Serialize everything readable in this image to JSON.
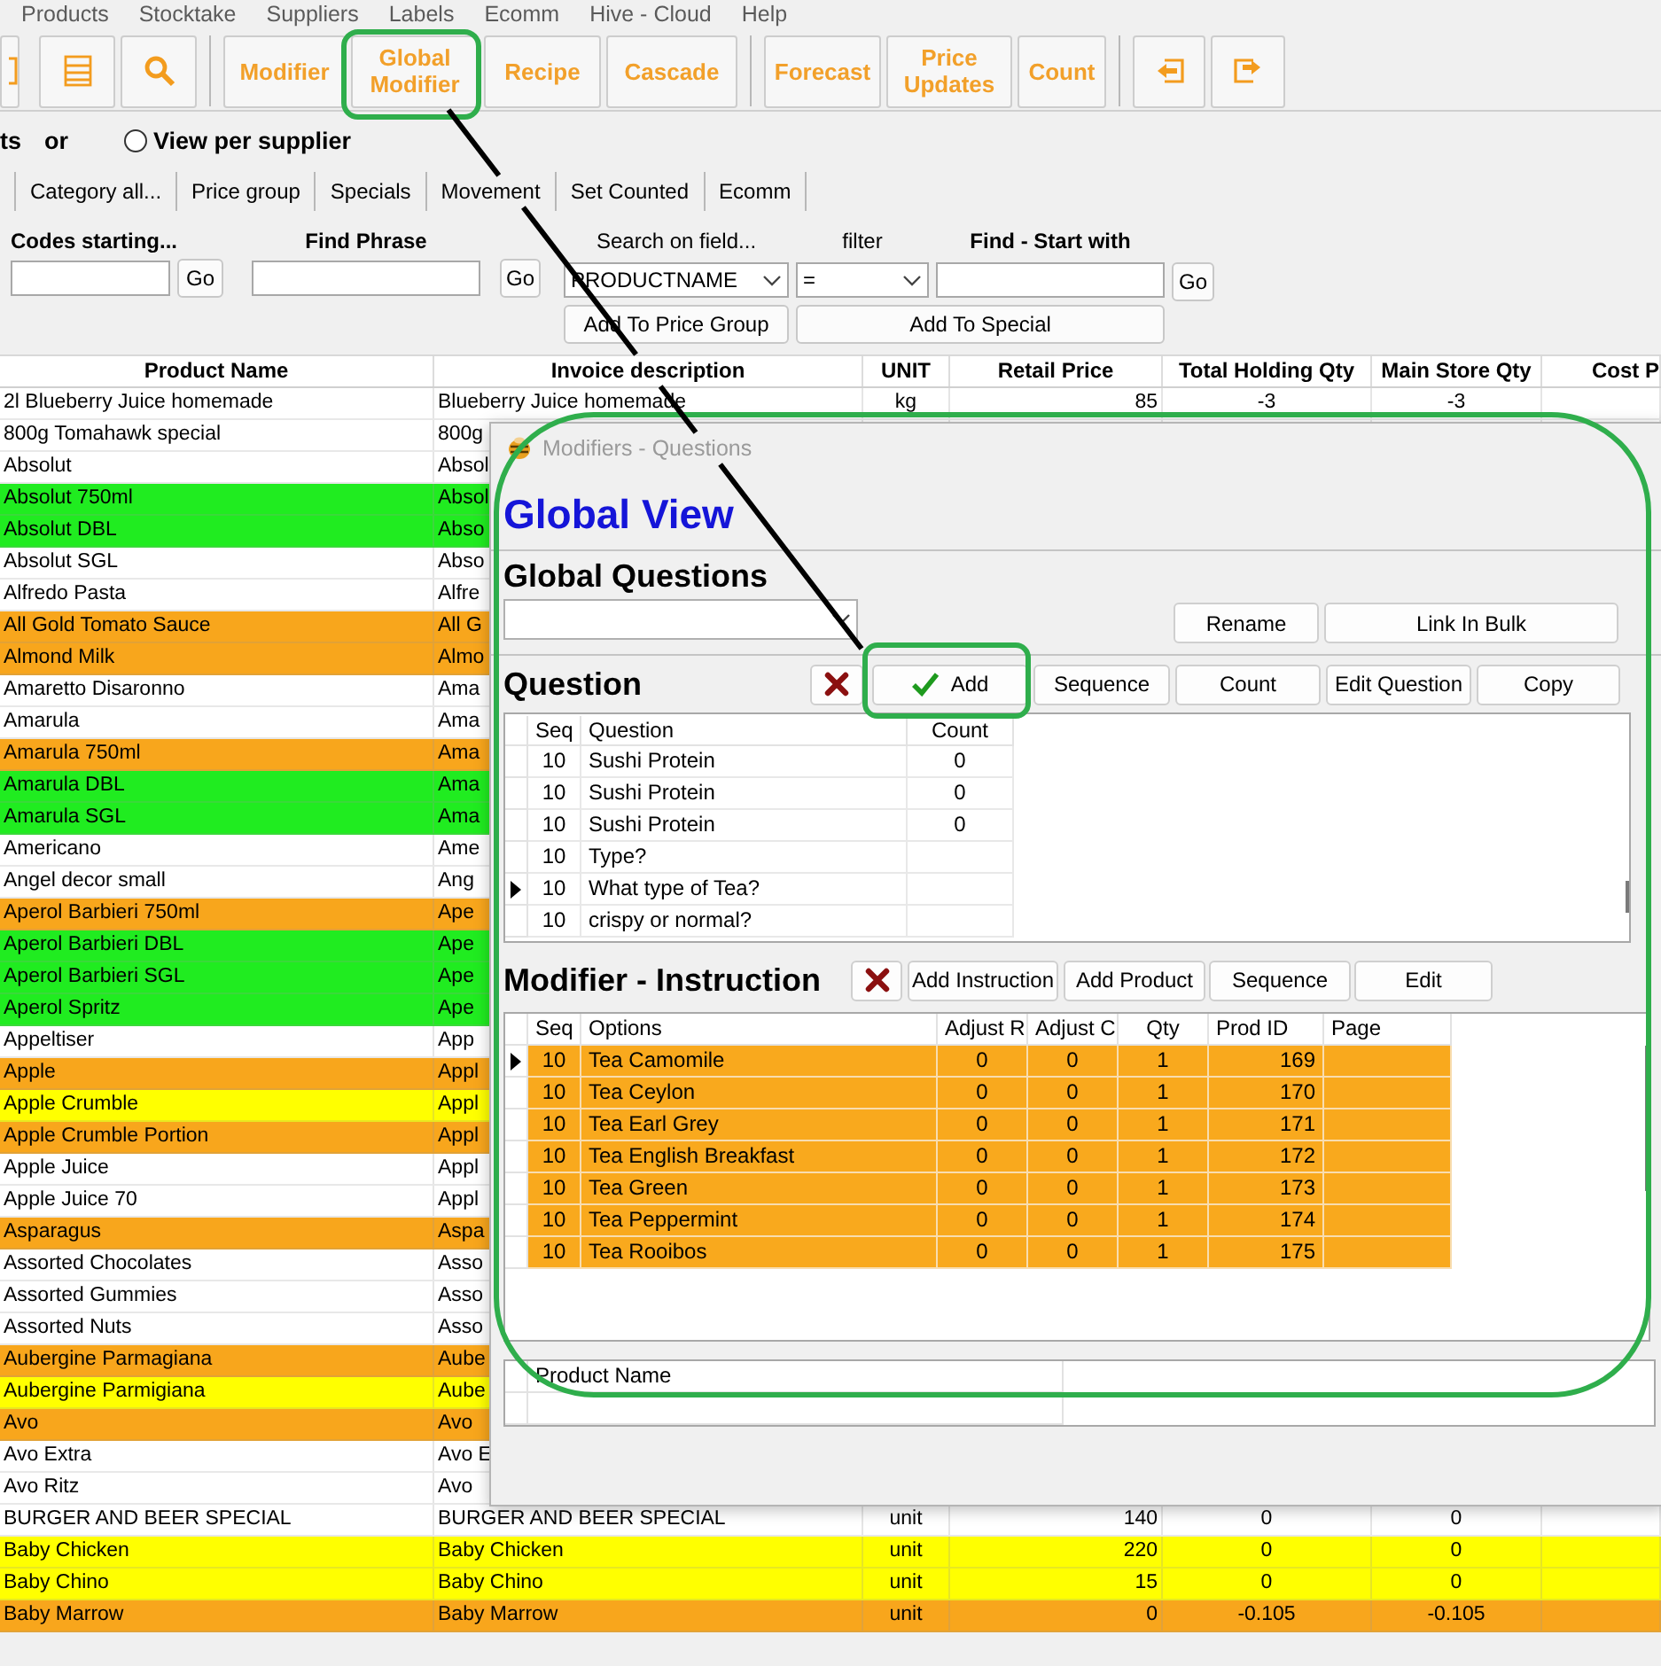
{
  "menu": [
    "Products",
    "Stocktake",
    "Suppliers",
    "Labels",
    "Ecomm",
    "Hive - Cloud",
    "Help"
  ],
  "toolbar": {
    "groups": [
      [
        "Modifier",
        "Global Modifier",
        "Recipe",
        "Cascade"
      ],
      [
        "Forecast",
        "Price Updates",
        "Count"
      ]
    ]
  },
  "view_options": {
    "cut_text": "ts",
    "or_text": "or",
    "radio": {
      "label": "View per supplier",
      "selected": false
    }
  },
  "filter_buttons": [
    "Category all...",
    "Price group",
    "Specials",
    "Movement",
    "Set Counted",
    "Ecomm"
  ],
  "search": {
    "codes_label": "Codes starting...",
    "codes_go": "Go",
    "phrase_label": "Find Phrase",
    "phrase_go": "Go",
    "field_label": "Search on field...",
    "field_value": "PRODUCTNAME",
    "filter_label": "filter",
    "filter_value": "=",
    "start_label": "Find - Start with",
    "start_go": "Go",
    "add_price_group": "Add To Price Group",
    "add_special": "Add To Special"
  },
  "table": {
    "columns": [
      "Product Name",
      "Invoice description",
      "UNIT",
      "Retail Price",
      "Total Holding Qty",
      "Main Store Qty",
      "Cost P"
    ],
    "rows": [
      {
        "name": "2l Blueberry Juice homemade",
        "invoice": "Blueberry Juice homemade",
        "unit": "kg",
        "retail": "85",
        "total": "-3",
        "main": "-3",
        "color": "#ffffff"
      },
      {
        "name": "800g Tomahawk special",
        "invoice": "800g",
        "color": "#ffffff"
      },
      {
        "name": "Absolut",
        "invoice": "Absol",
        "color": "#ffffff"
      },
      {
        "name": "Absolut 750ml",
        "invoice": "Absol",
        "color": "#20ec20"
      },
      {
        "name": "Absolut DBL",
        "invoice": "Abso",
        "color": "#20ec20"
      },
      {
        "name": "Absolut SGL",
        "invoice": "Abso",
        "color": "#ffffff"
      },
      {
        "name": "Alfredo Pasta",
        "invoice": "Alfre",
        "color": "#ffffff"
      },
      {
        "name": "All Gold Tomato Sauce",
        "invoice": "All G",
        "color": "#f8a61c"
      },
      {
        "name": "Almond Milk",
        "invoice": "Almo",
        "color": "#f8a61c"
      },
      {
        "name": "Amaretto Disaronno",
        "invoice": "Ama",
        "color": "#ffffff"
      },
      {
        "name": "Amarula",
        "invoice": "Ama",
        "color": "#ffffff"
      },
      {
        "name": "Amarula 750ml",
        "invoice": "Ama",
        "color": "#f8a61c"
      },
      {
        "name": "Amarula DBL",
        "invoice": "Ama",
        "color": "#20ec20"
      },
      {
        "name": "Amarula SGL",
        "invoice": "Ama",
        "color": "#20ec20"
      },
      {
        "name": "Americano",
        "invoice": "Ame",
        "color": "#ffffff"
      },
      {
        "name": "Angel decor small",
        "invoice": "Ang",
        "color": "#ffffff"
      },
      {
        "name": "Aperol Barbieri 750ml",
        "invoice": "Ape",
        "color": "#f8a61c"
      },
      {
        "name": "Aperol Barbieri DBL",
        "invoice": "Ape",
        "color": "#20ec20"
      },
      {
        "name": "Aperol Barbieri SGL",
        "invoice": "Ape",
        "color": "#20ec20"
      },
      {
        "name": "Aperol Spritz",
        "invoice": "Ape",
        "color": "#20ec20"
      },
      {
        "name": "Appeltiser",
        "invoice": "App",
        "color": "#ffffff"
      },
      {
        "name": "Apple",
        "invoice": "Appl",
        "color": "#f8a61c"
      },
      {
        "name": "Apple Crumble",
        "invoice": "Appl",
        "color": "#ffff00"
      },
      {
        "name": "Apple Crumble Portion",
        "invoice": "Appl",
        "color": "#f8a61c"
      },
      {
        "name": "Apple Juice",
        "invoice": "Appl",
        "color": "#ffffff"
      },
      {
        "name": "Apple Juice 70",
        "invoice": "Appl",
        "color": "#ffffff"
      },
      {
        "name": "Asparagus",
        "invoice": "Aspa",
        "color": "#f8a61c"
      },
      {
        "name": "Assorted Chocolates",
        "invoice": "Asso",
        "color": "#ffffff"
      },
      {
        "name": "Assorted Gummies",
        "invoice": "Asso",
        "color": "#ffffff"
      },
      {
        "name": "Assorted Nuts",
        "invoice": "Asso",
        "color": "#ffffff"
      },
      {
        "name": "Aubergine Parmagiana",
        "invoice": "Aube",
        "color": "#f8a61c"
      },
      {
        "name": "Aubergine Parmigiana",
        "invoice": "Aube",
        "color": "#ffff00"
      },
      {
        "name": "Avo",
        "invoice": "Avo",
        "color": "#f8a61c"
      },
      {
        "name": "Avo Extra",
        "invoice": "Avo E",
        "color": "#ffffff"
      },
      {
        "name": "Avo Ritz",
        "invoice": "Avo",
        "color": "#ffffff"
      },
      {
        "name": "BURGER AND BEER SPECIAL",
        "invoice": "BURGER AND BEER SPECIAL",
        "unit": "unit",
        "retail": "140",
        "total": "0",
        "main": "0",
        "color": "#ffffff"
      },
      {
        "name": "Baby Chicken",
        "invoice": "Baby Chicken",
        "unit": "unit",
        "retail": "220",
        "total": "0",
        "main": "0",
        "color": "#ffff00"
      },
      {
        "name": "Baby Chino",
        "invoice": "Baby Chino",
        "unit": "unit",
        "retail": "15",
        "total": "0",
        "main": "0",
        "color": "#ffff00"
      },
      {
        "name": "Baby Marrow",
        "invoice": "Baby Marrow",
        "unit": "unit",
        "retail": "0",
        "total": "-0.105",
        "main": "-0.105",
        "color": "#f8a61c"
      }
    ]
  },
  "dialog": {
    "title": "Modifiers - Questions",
    "heading": "Global View",
    "global_questions": {
      "label": "Global Questions",
      "buttons": [
        "Rename",
        "Link In Bulk"
      ]
    },
    "question": {
      "label": "Question",
      "buttons": [
        {
          "label": "Add",
          "kind": "add"
        },
        {
          "label": "Sequence",
          "kind": "plain"
        },
        {
          "label": "Count",
          "kind": "plain"
        },
        {
          "label": "Edit Question",
          "kind": "plain"
        },
        {
          "label": "Copy",
          "kind": "plain"
        }
      ],
      "columns": [
        "Seq",
        "Question",
        "Count"
      ],
      "rows": [
        {
          "seq": "10",
          "question": "Sushi Protein",
          "count": "0",
          "selected": false
        },
        {
          "seq": "10",
          "question": "Sushi Protein",
          "count": "0",
          "selected": false
        },
        {
          "seq": "10",
          "question": "Sushi Protein",
          "count": "0",
          "selected": false
        },
        {
          "seq": "10",
          "question": "Type?",
          "selected": false
        },
        {
          "seq": "10",
          "question": "What type of Tea?",
          "selected": true
        },
        {
          "seq": "10",
          "question": "crispy or normal?",
          "selected": false
        }
      ]
    },
    "instruction": {
      "label": "Modifier - Instruction",
      "buttons": [
        "Add Instruction",
        "Add Product",
        "Sequence",
        "Edit"
      ],
      "columns": [
        "Seq",
        "Options",
        "Adjust R",
        "Adjust C",
        "Qty",
        "Prod ID",
        "Page"
      ],
      "rows": [
        {
          "seq": "10",
          "option": "Tea Camomile",
          "adjust_r": "0",
          "adjust_c": "0",
          "qty": "1",
          "prod_id": "169",
          "selected": true
        },
        {
          "seq": "10",
          "option": "Tea Ceylon",
          "adjust_r": "0",
          "adjust_c": "0",
          "qty": "1",
          "prod_id": "170",
          "selected": false
        },
        {
          "seq": "10",
          "option": "Tea Earl Grey",
          "adjust_r": "0",
          "adjust_c": "0",
          "qty": "1",
          "prod_id": "171",
          "selected": false
        },
        {
          "seq": "10",
          "option": "Tea English Breakfast",
          "adjust_r": "0",
          "adjust_c": "0",
          "qty": "1",
          "prod_id": "172",
          "selected": false
        },
        {
          "seq": "10",
          "option": "Tea Green",
          "adjust_r": "0",
          "adjust_c": "0",
          "qty": "1",
          "prod_id": "173",
          "selected": false
        },
        {
          "seq": "10",
          "option": "Tea Peppermint",
          "adjust_r": "0",
          "adjust_c": "0",
          "qty": "1",
          "prod_id": "174",
          "selected": false
        },
        {
          "seq": "10",
          "option": "Tea Rooibos",
          "adjust_r": "0",
          "adjust_c": "0",
          "qty": "1",
          "prod_id": "175",
          "selected": false
        }
      ]
    },
    "products": {
      "columns": [
        "Product Name"
      ]
    }
  }
}
